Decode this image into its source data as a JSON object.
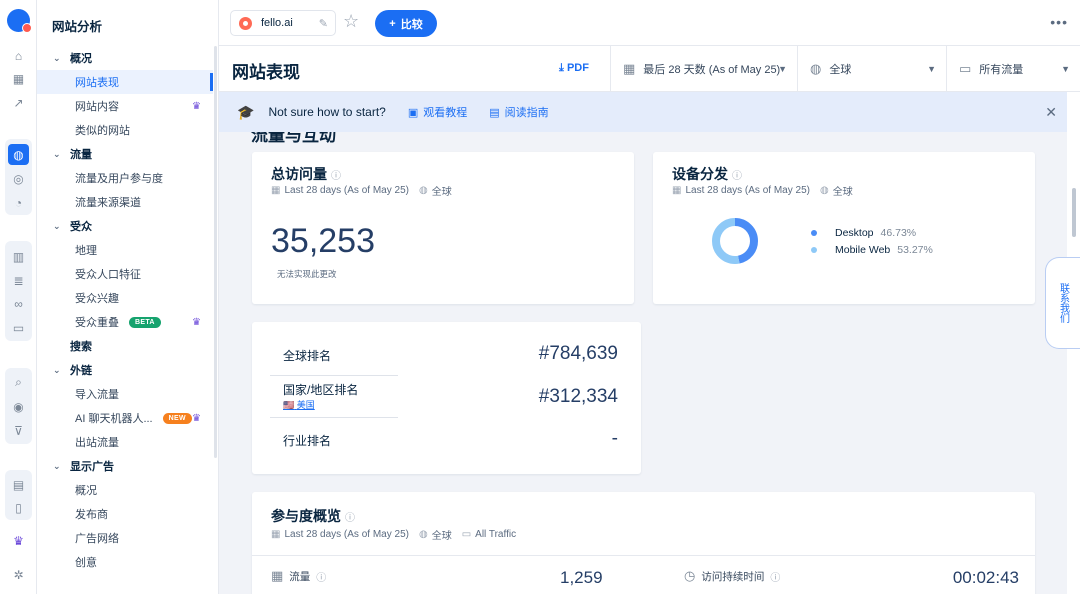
{
  "nav": {
    "title": "网站分析",
    "sections": [
      {
        "label": "概况",
        "chevron": true,
        "items": [
          {
            "label": "网站表现",
            "active": true
          },
          {
            "label": "网站内容",
            "crown": true
          },
          {
            "label": "类似的网站"
          }
        ]
      },
      {
        "label": "流量",
        "chevron": true,
        "items": [
          {
            "label": "流量及用户参与度"
          },
          {
            "label": "流量来源渠道"
          }
        ]
      },
      {
        "label": "受众",
        "chevron": true,
        "items": [
          {
            "label": "地理"
          },
          {
            "label": "受众人口特征"
          },
          {
            "label": "受众兴趣"
          },
          {
            "label": "受众重叠",
            "badge": "BETA",
            "badge_type": "beta",
            "crown": true
          }
        ]
      },
      {
        "label": "搜索",
        "chevron": false,
        "items": []
      },
      {
        "label": "外链",
        "chevron": true,
        "items": [
          {
            "label": "导入流量"
          },
          {
            "label": "AI 聊天机器人...",
            "badge": "NEW",
            "badge_type": "new",
            "crown": true
          },
          {
            "label": "出站流量"
          }
        ]
      },
      {
        "label": "显示广告",
        "chevron": true,
        "items": [
          {
            "label": "概况"
          },
          {
            "label": "发布商"
          },
          {
            "label": "广告网络"
          },
          {
            "label": "创意"
          }
        ]
      }
    ]
  },
  "topbar": {
    "site": "fello.ai",
    "compare_label": "比较"
  },
  "header": {
    "title": "网站表现",
    "pdf_label": "PDF",
    "date_filter": "最后 28 天数 (As of May 25)",
    "country_filter": "全球",
    "traffic_filter": "所有流量"
  },
  "banner": {
    "text": "Not sure how to start?",
    "link1": "观看教程",
    "link2": "阅读指南"
  },
  "section_title_cut": "流量与互动",
  "visits": {
    "title": "总访问量",
    "period": "Last 28 days (As of May 25)",
    "country": "全球",
    "value": "35,253",
    "note": "无法实现此更改"
  },
  "device": {
    "title": "设备分发",
    "period": "Last 28 days (As of May 25)",
    "country": "全球",
    "legend": [
      {
        "name": "Desktop",
        "pct": "46.73%",
        "value": 46.73,
        "color": "#4a8cf6"
      },
      {
        "name": "Mobile Web",
        "pct": "53.27%",
        "value": 53.27,
        "color": "#8ec9f7"
      }
    ]
  },
  "ranks": {
    "global_label": "全球排名",
    "global_value": "#784,639",
    "country_label": "国家/地区排名",
    "country_name": "美国",
    "country_value": "#312,334",
    "category_label": "行业排名",
    "category_value": "-"
  },
  "engagement": {
    "title": "参与度概览",
    "period": "Last 28 days (As of May 25)",
    "country": "全球",
    "traffic": "All Traffic",
    "visits_label": "流量",
    "visits_value": "1,259",
    "duration_label": "访问持续时间",
    "duration_value": "00:02:43"
  },
  "side_tab": "联系我们"
}
